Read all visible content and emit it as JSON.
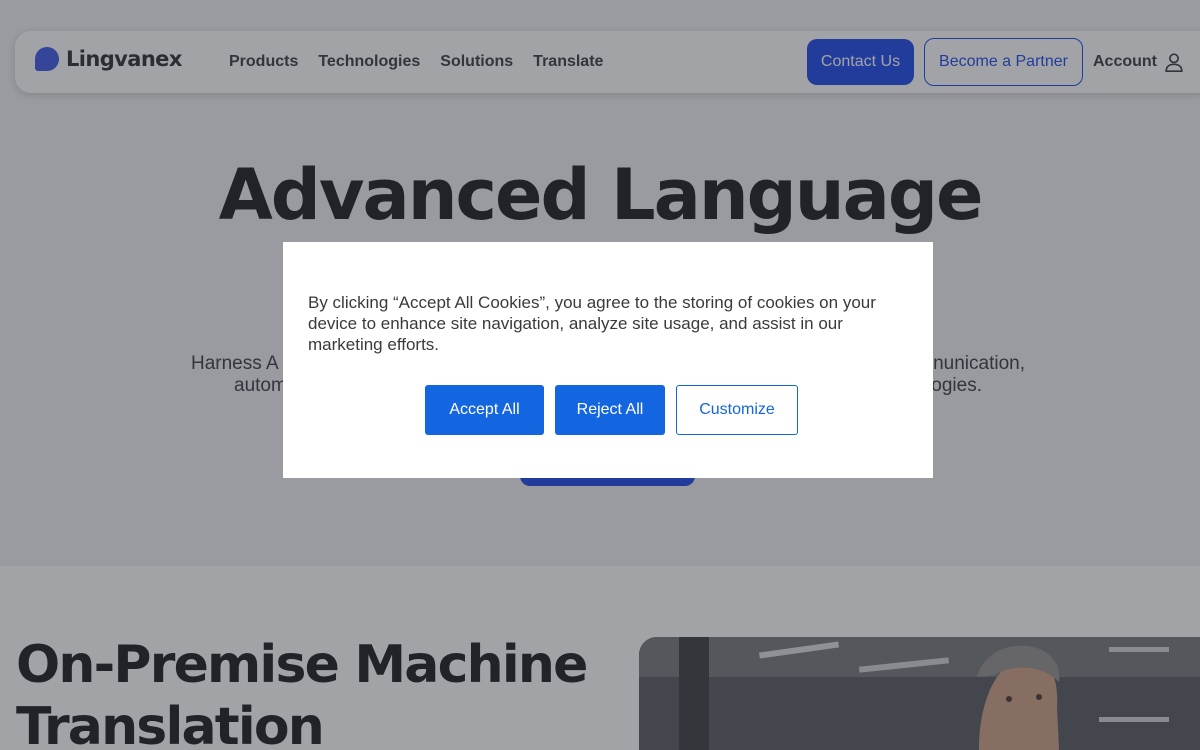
{
  "header": {
    "logo_text": "Lingvanex",
    "nav": [
      "Products",
      "Technologies",
      "Solutions",
      "Translate"
    ],
    "contact_label": "Contact Us",
    "partner_label": "Become a Partner",
    "account_label": "Account"
  },
  "hero": {
    "title": "Advanced Language",
    "subtitle_left": "Harness A",
    "subtitle_right": "nunication,",
    "subtitle_left2": "autom",
    "subtitle_right2": "ogies."
  },
  "section": {
    "title": "On-Premise Machine Translation"
  },
  "cookie_banner": {
    "text": "By clicking “Accept All Cookies”, you agree to the storing of cookies on your device to enhance site navigation, analyze site usage, and assist in our marketing efforts.",
    "accept_label": "Accept All",
    "reject_label": "Reject All",
    "customize_label": "Customize"
  },
  "colors": {
    "brand_blue": "#0a3ae8",
    "cookie_blue": "#1466e0"
  },
  "icons": {
    "account": "user-icon"
  }
}
